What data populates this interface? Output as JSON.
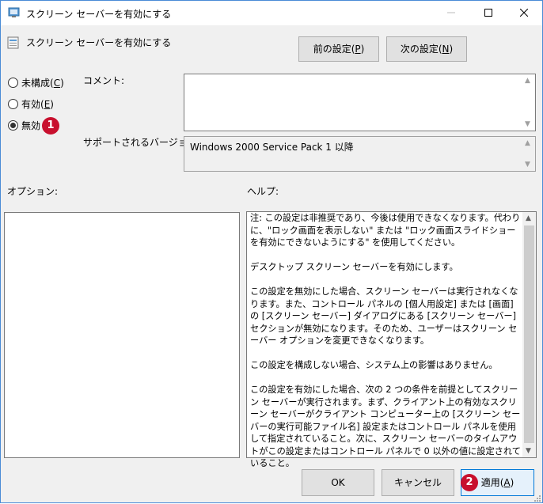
{
  "window": {
    "title": "スクリーン セーバーを有効にする"
  },
  "policy": {
    "title": "スクリーン セーバーを有効にする"
  },
  "nav": {
    "prev_label": "前の設定(",
    "prev_key": "P",
    "prev_close": ")",
    "next_label": "次の設定(",
    "next_key": "N",
    "next_close": ")"
  },
  "state": {
    "options": [
      {
        "label": "未構成(",
        "key": "C",
        "close": ")",
        "checked": false
      },
      {
        "label": "有効(",
        "key": "E",
        "close": ")",
        "checked": false
      },
      {
        "label": "無効",
        "key": "",
        "close": "",
        "checked": true
      }
    ]
  },
  "labels": {
    "comment": "コメント:",
    "supported": "サポートされるバージョン:",
    "options": "オプション:",
    "help": "ヘルプ:"
  },
  "comment": {
    "value": ""
  },
  "supported": {
    "value": "Windows 2000 Service Pack 1 以降"
  },
  "help": {
    "paragraphs": [
      "注: この設定は非推奨であり、今後は使用できなくなります。代わりに、\"ロック画面を表示しない\" または \"ロック画面スライドショーを有効にできないようにする\" を使用してください。",
      "デスクトップ スクリーン セーバーを有効にします。",
      "この設定を無効にした場合、スクリーン セーバーは実行されなくなります。また、コントロール パネルの [個人用設定] または [画面] の [スクリーン セーバー] ダイアログにある [スクリーン セーバー] セクションが無効になります。そのため、ユーザーはスクリーン セーバー オプションを変更できなくなります。",
      "この設定を構成しない場合、システム上の影響はありません。",
      "この設定を有効にした場合、次の 2 つの条件を前提としてスクリーン セーバーが実行されます。まず、クライアント上の有効なスクリーン セーバーがクライアント コンピューター上の [スクリーン セーバーの実行可能ファイル名] 設定またはコントロール パネルを使用して指定されていること。次に、スクリーン セーバーのタイムアウトがこの設定またはコントロール パネルで 0 以外の値に設定されていること。"
    ]
  },
  "buttons": {
    "ok": "OK",
    "cancel": "キャンセル",
    "apply_label": "適用(",
    "apply_key": "A",
    "apply_close": ")"
  },
  "badges": {
    "one": "1",
    "two": "2"
  },
  "colors": {
    "badge": "#c8102e",
    "accent": "#0078d7"
  }
}
